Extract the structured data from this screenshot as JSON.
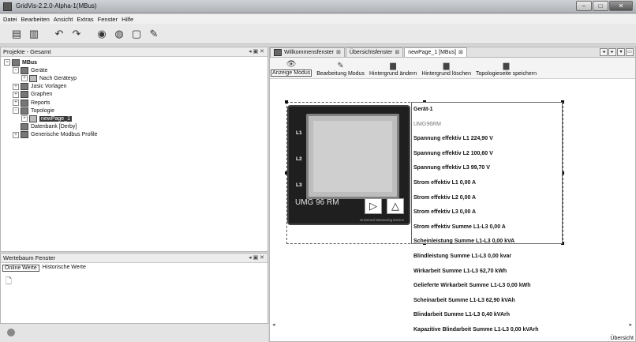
{
  "window": {
    "title": "GridVis-2.2.0-Alpha-1(MBus)",
    "controls": [
      "–",
      "□",
      "✕"
    ]
  },
  "menu": [
    "Datei",
    "Bearbeiten",
    "Ansicht",
    "Extras",
    "Fenster",
    "Hilfe"
  ],
  "toolbar_icons": [
    "open-project-icon",
    "save-icon",
    "undo-icon",
    "redo-icon",
    "online-icon",
    "record-icon",
    "new-icon",
    "tools-icon"
  ],
  "projects_panel": {
    "title": "Projekte - Gesamt",
    "controls": "◂ ▣ ✕",
    "tree": [
      {
        "label": "MBus",
        "level": 0,
        "expander": "⊟",
        "bold": true
      },
      {
        "label": "Geräte",
        "level": 1,
        "expander": "⊟"
      },
      {
        "label": "Nach Geräteyp",
        "level": 2,
        "expander": "⊞"
      },
      {
        "label": "Jasic Vorlagen",
        "level": 1,
        "expander": "⊞"
      },
      {
        "label": "Graphen",
        "level": 1,
        "expander": "⊞"
      },
      {
        "label": "Reports",
        "level": 1,
        "expander": "⊞"
      },
      {
        "label": "Topologie",
        "level": 1,
        "expander": "⊟"
      },
      {
        "label": "newPage_1",
        "level": 2,
        "expander": "⊞",
        "selected": true
      },
      {
        "label": "Datenbank [Derby]",
        "level": 1,
        "expander": ""
      },
      {
        "label": "Generische Modbus Profile",
        "level": 1,
        "expander": "⊞"
      }
    ]
  },
  "values_panel": {
    "title": "Wertebaum Fenster",
    "controls": "◂ ▣ ✕",
    "tabs": [
      "Online Werte",
      "Historische Werte"
    ]
  },
  "editor": {
    "tabs": [
      {
        "label": "Willkommensfenster",
        "active": false
      },
      {
        "label": "Übersichtsfenster",
        "active": false
      },
      {
        "label": "newPage_1 [MBus]",
        "active": true
      }
    ],
    "nav": [
      "◂",
      "▸",
      "▾",
      "▭"
    ],
    "actions": [
      {
        "icon": "eye-icon",
        "glyph": "👁",
        "label": "Anzeige Modus",
        "active": true
      },
      {
        "icon": "edit-icon",
        "glyph": "✎",
        "label": "Bearbeitung Modus",
        "active": false
      },
      {
        "icon": "background-icon",
        "glyph": "▆",
        "label": "Hintergrund ändern",
        "active": false
      },
      {
        "icon": "delete-background-icon",
        "glyph": "▆",
        "label": "Hintergrund löschen",
        "active": false
      },
      {
        "icon": "save-topology-icon",
        "glyph": "▆",
        "label": "Topologieseite speichern",
        "active": false
      }
    ],
    "status_right": "Übersicht"
  },
  "device": {
    "model": "UMG 96 RM",
    "subtitle": "Universal Measuring Device",
    "leds": [
      "L1",
      "L2",
      "L3"
    ],
    "buttons": [
      "▷",
      "△"
    ],
    "info": [
      {
        "text": "Gerät-1",
        "light": false
      },
      {
        "text": "UMG96RM",
        "light": true
      },
      {
        "text": "Spannung effektiv L1 224,90 V",
        "light": false
      },
      {
        "text": "Spannung effektiv L2 100,60 V",
        "light": false
      },
      {
        "text": "Spannung effektiv L3  99,70 V",
        "light": false
      },
      {
        "text": "Strom effektiv L1   0,00 A",
        "light": false
      },
      {
        "text": "Strom effektiv L2   0,00 A",
        "light": false
      },
      {
        "text": "Strom effektiv L3   0,00 A",
        "light": false
      },
      {
        "text": "Strom effektiv Summe L1-L3   0,00 A",
        "light": false
      },
      {
        "text": "Scheinleistung Summe L1-L3 0,00 kVA",
        "light": false
      },
      {
        "text": "Blindleistung Summe L1-L3 0,00 kvar",
        "light": false
      },
      {
        "text": "Wirkarbeit Summe L1-L3 62,70 kWh",
        "light": false
      },
      {
        "text": "Gelieferte Wirkarbeit Summe L1-L3 0,00 kWh",
        "light": false
      },
      {
        "text": "Scheinarbeit Summe L1-L3 62,90 kVAh",
        "light": false
      },
      {
        "text": "Blindarbeit Summe L1-L3 0,40 kVArh",
        "light": false
      },
      {
        "text": "Kapazitive Blindarbeit Summe L1-L3 0,00 kVArh",
        "light": false
      }
    ]
  }
}
